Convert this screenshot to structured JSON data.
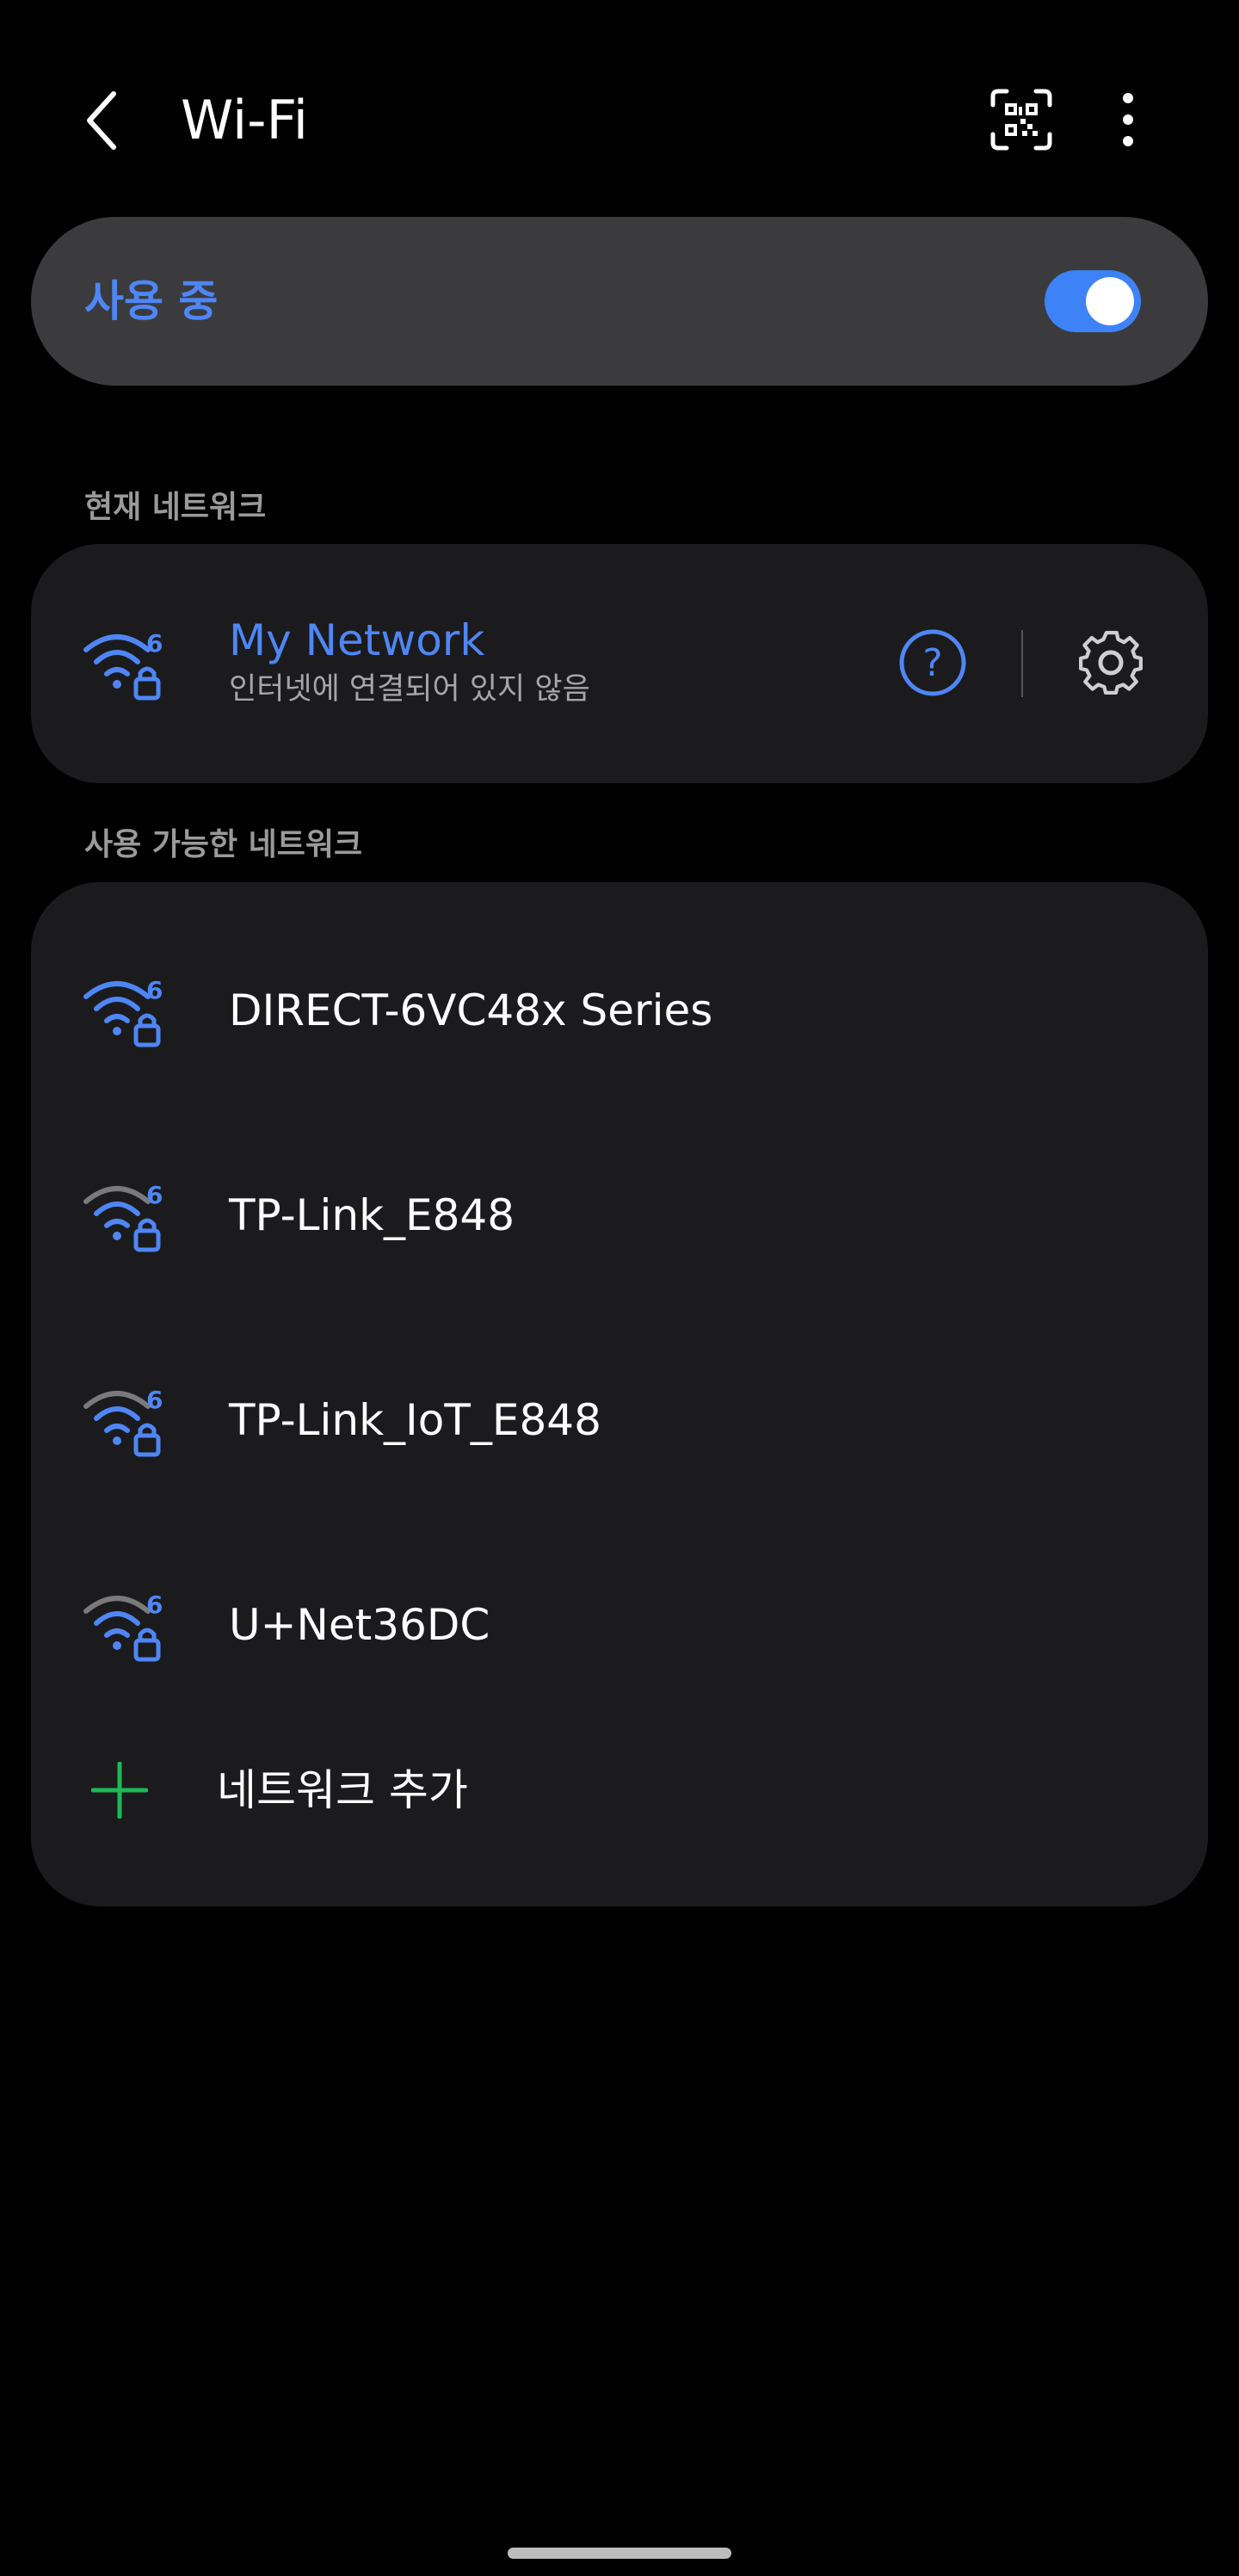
{
  "header": {
    "title": "Wi-Fi"
  },
  "toggle": {
    "label": "사용 중",
    "on": true,
    "accent": "#3e82f7"
  },
  "current": {
    "section_label": "현재 네트워크",
    "network": {
      "name": "My Network",
      "status": "인터넷에 연결되어 있지 않음",
      "badge": "6",
      "icon": "wifi-6-lock-icon"
    }
  },
  "available": {
    "section_label": "사용 가능한 네트워크",
    "networks": [
      {
        "name": "DIRECT-6VC48x Series",
        "badge": "6",
        "signal": "full",
        "icon": "wifi-6-lock-icon"
      },
      {
        "name": "TP-Link_E848",
        "badge": "6",
        "signal": "medium",
        "icon": "wifi-6-lock-icon"
      },
      {
        "name": "TP-Link_IoT_E848",
        "badge": "6",
        "signal": "medium",
        "icon": "wifi-6-lock-icon"
      },
      {
        "name": "U+Net36DC",
        "badge": "6",
        "signal": "medium",
        "icon": "wifi-6-lock-icon"
      }
    ],
    "add_label": "네트워크 추가"
  },
  "colors": {
    "accent": "#4f86f5",
    "card": "#1b1b1d",
    "toggle_card": "#3b3b3d",
    "add_green": "#1db954"
  }
}
